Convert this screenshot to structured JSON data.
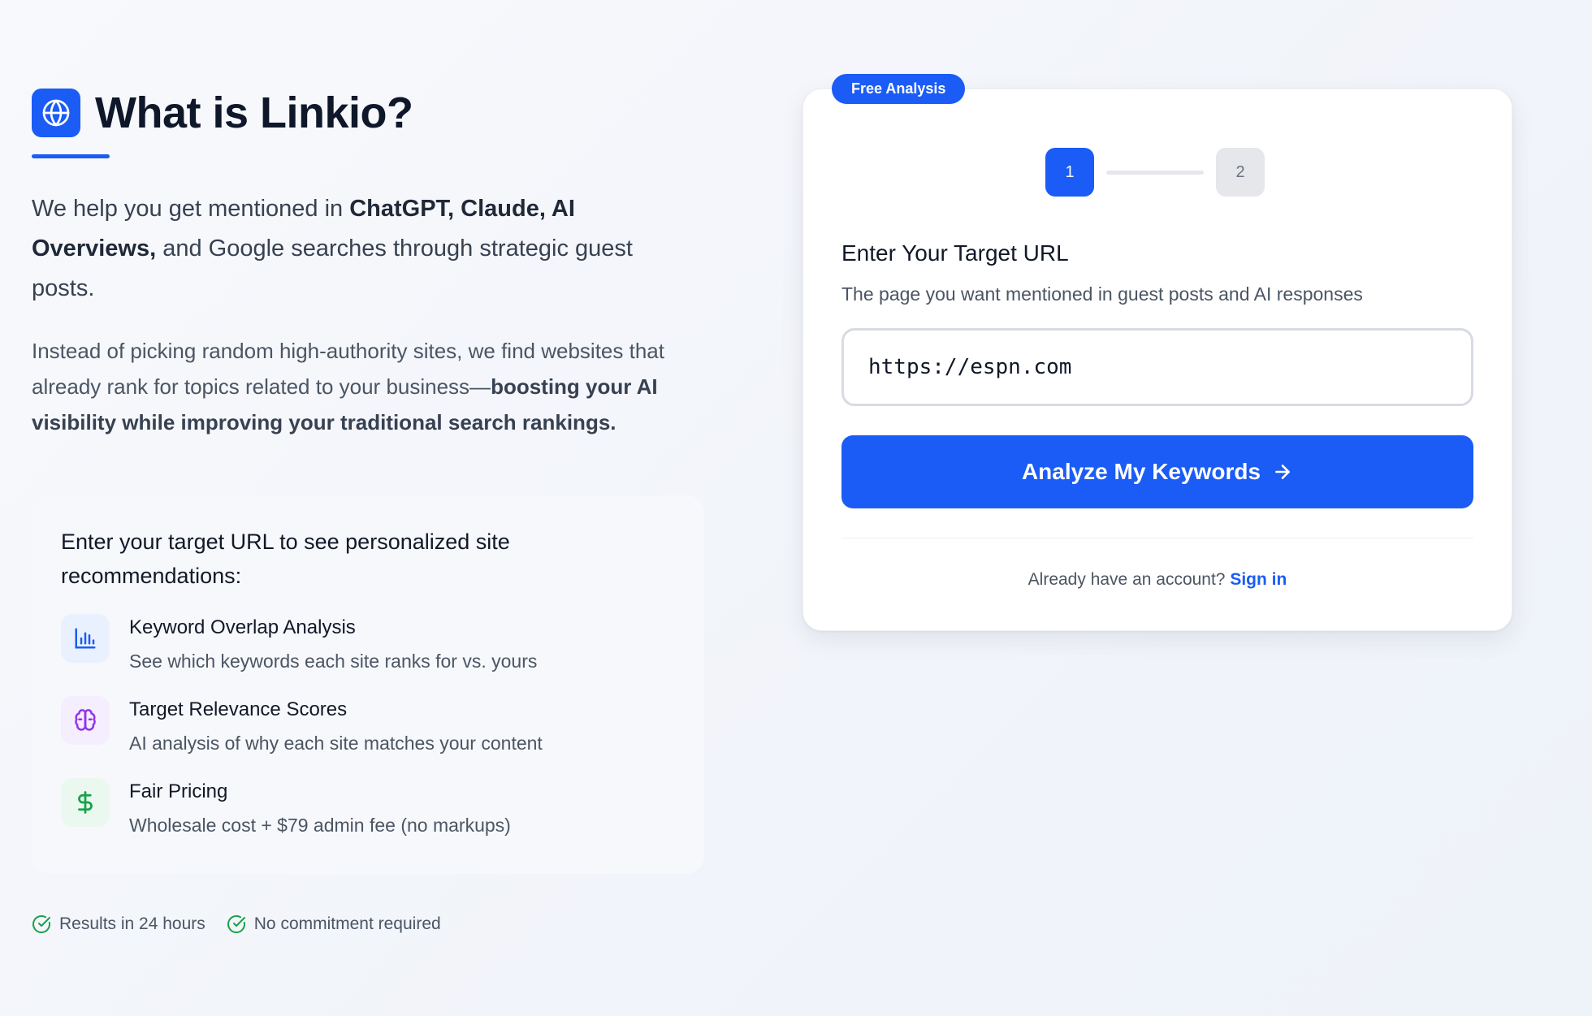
{
  "hero": {
    "title": "What is Linkio?",
    "logo_icon": "globe-icon",
    "lead_prefix": "We help you get mentioned in ",
    "lead_bold": "ChatGPT, Claude, AI Overviews,",
    "lead_suffix": " and Google searches through strategic guest posts.",
    "body_prefix": "Instead of picking random high-authority sites, we find websites that already rank for topics related to your business—",
    "body_bold": "boosting your AI visibility while improving your traditional search rankings."
  },
  "features": {
    "heading": "Enter your target URL to see personalized site recommendations:",
    "items": [
      {
        "icon": "bar-chart-icon",
        "title": "Keyword Overlap Analysis",
        "description": "See which keywords each site ranks for vs. yours"
      },
      {
        "icon": "brain-icon",
        "title": "Target Relevance Scores",
        "description": "AI analysis of why each site matches your content"
      },
      {
        "icon": "dollar-icon",
        "title": "Fair Pricing",
        "description": "Wholesale cost + $79 admin fee (no markups)"
      }
    ]
  },
  "badges": [
    {
      "icon": "check-circle-icon",
      "label": "Results in 24 hours"
    },
    {
      "icon": "check-circle-icon",
      "label": "No commitment required"
    }
  ],
  "card": {
    "pill": "Free Analysis",
    "steps": [
      "1",
      "2"
    ],
    "active_step": 1,
    "title": "Enter Your Target URL",
    "subtitle": "The page you want mentioned in guest posts and AI responses",
    "url_value": "https://espn.com",
    "cta_label": "Analyze My Keywords",
    "signin_prompt": "Already have an account?",
    "signin_link": "Sign in"
  },
  "colors": {
    "brand_blue": "#1a5cf5",
    "purple_accent": "#9333ea",
    "green_accent": "#16a34a"
  }
}
